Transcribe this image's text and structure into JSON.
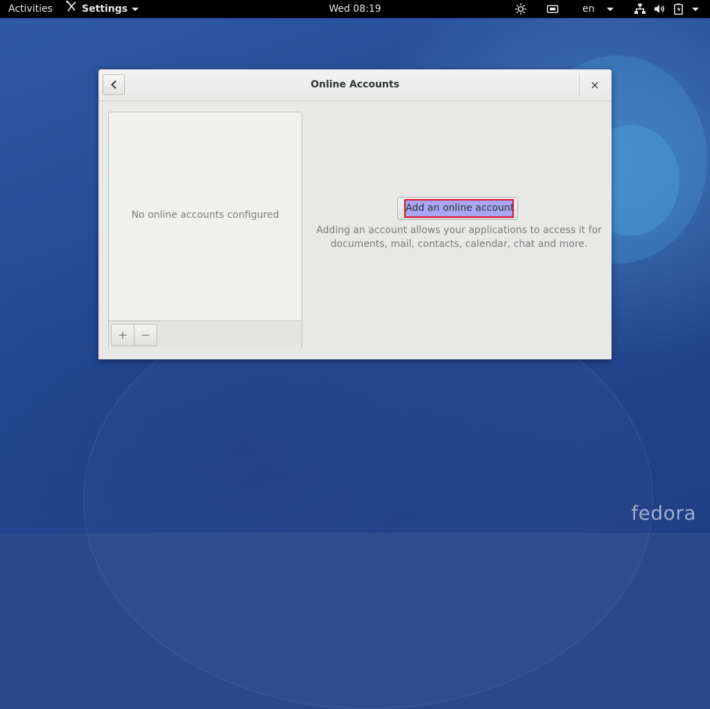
{
  "topbar": {
    "activities": "Activities",
    "app_menu": "Settings",
    "clock": "Wed 08:19",
    "language": "en"
  },
  "window": {
    "title": "Online Accounts",
    "close_label": "×",
    "list": {
      "empty_text": "No online accounts configured",
      "add_label": "+",
      "remove_label": "−"
    },
    "add_account": {
      "button_label": "Add an online account",
      "description_line1": "Adding an account allows your applications to access it for",
      "description_line2": "documents, mail, contacts, calendar, chat and more."
    }
  },
  "desktop": {
    "logo_text": "fedora"
  },
  "colors": {
    "highlight_border": "#e00b1c",
    "button_selected": "#a6a6f2"
  }
}
